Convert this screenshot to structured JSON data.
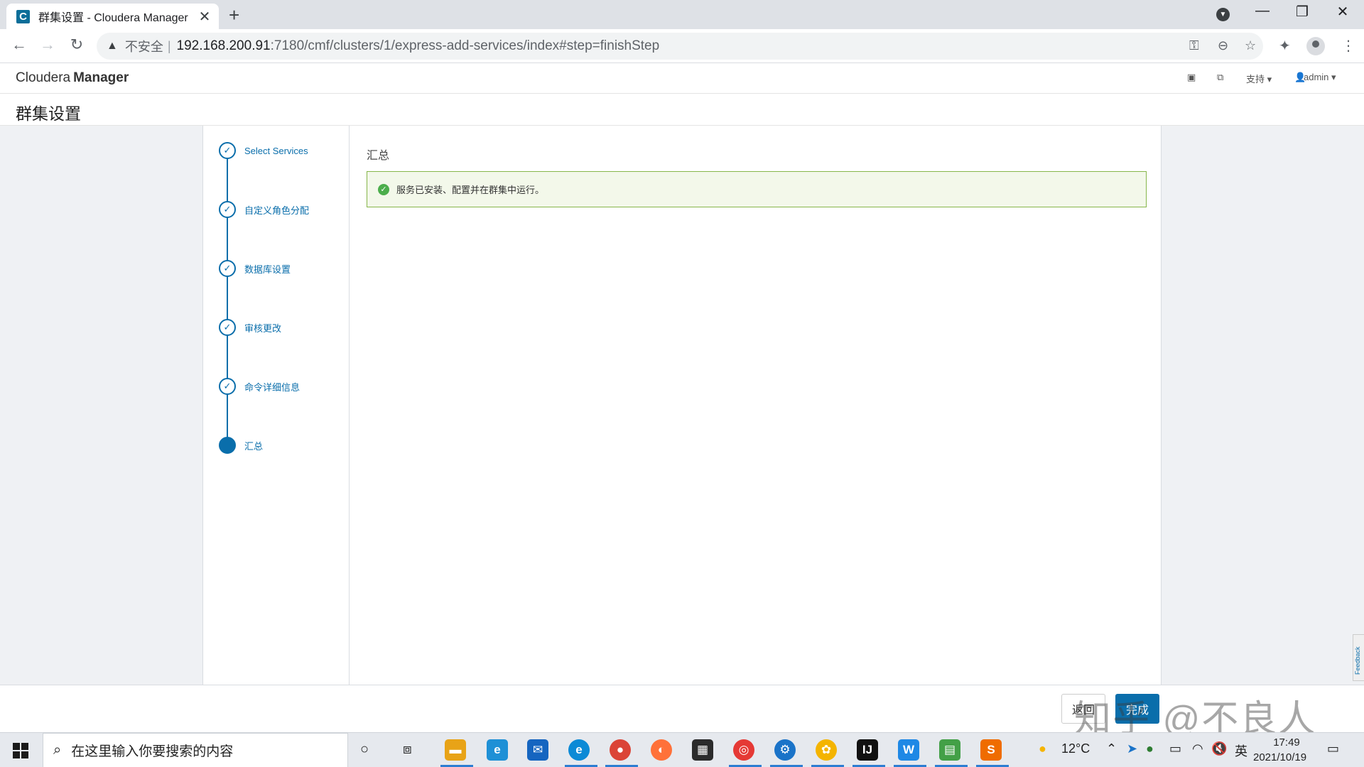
{
  "browser": {
    "tab_title": "群集设置 - Cloudera Manager",
    "tab_close": "✕",
    "new_tab": "+",
    "insecure_label": "不安全",
    "url_host": "192.168.200.91",
    "url_rest": ":7180/cmf/clusters/1/express-add-services/index#step=finishStep",
    "favicon_letter": "C"
  },
  "app": {
    "brand_light": "Cloudera",
    "brand_bold": "Manager",
    "support_label": "支持 ▾",
    "user_label": "admin ▾",
    "page_title": "群集设置"
  },
  "wizard": {
    "steps": [
      {
        "label": "Select Services",
        "state": "done"
      },
      {
        "label": "自定义角色分配",
        "state": "done"
      },
      {
        "label": "数据库设置",
        "state": "done"
      },
      {
        "label": "审核更改",
        "state": "done"
      },
      {
        "label": "命令详细信息",
        "state": "done"
      },
      {
        "label": "汇总",
        "state": "active"
      }
    ],
    "section_title": "汇总",
    "alert_text": "服务已安装、配置并在群集中运行。",
    "back_label": "返回",
    "finish_label": "完成",
    "feedback_label": "Feedback"
  },
  "watermark": "知乎 @不良人",
  "taskbar": {
    "search_placeholder": "在这里输入你要搜索的内容",
    "weather": "12°C",
    "ime": "英",
    "time": "17:49",
    "date": "2021/10/19"
  },
  "colors": {
    "accent": "#0a6eab",
    "alert_border": "#86b64a",
    "alert_bg": "#f3f8ea",
    "success": "#4cae4c",
    "page_bg": "#eff1f4"
  }
}
